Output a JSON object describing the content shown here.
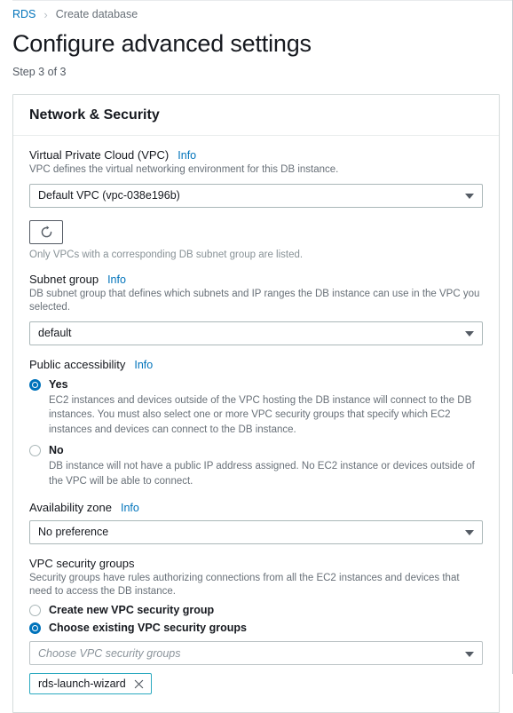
{
  "breadcrumb": {
    "root": "RDS",
    "separator": "›",
    "current": "Create database"
  },
  "header": {
    "title": "Configure advanced settings",
    "step": "Step 3 of 3"
  },
  "panel": {
    "title": "Network & Security"
  },
  "colors": {
    "link": "#0073bb",
    "accent_radio": "#0073bb",
    "token_border": "#2aa9bf",
    "label_text": "#16191f",
    "desc_text": "#687078"
  },
  "fields": {
    "vpc": {
      "label": "Virtual Private Cloud (VPC)",
      "info": "Info",
      "description": "VPC defines the virtual networking environment for this DB instance.",
      "value": "Default VPC (vpc-038e196b)"
    },
    "refresh": {
      "icon": "refresh-icon",
      "note": "Only VPCs with a corresponding DB subnet group are listed."
    },
    "subnet_group": {
      "label": "Subnet group",
      "info": "Info",
      "description": "DB subnet group that defines which subnets and IP ranges the DB instance can use in the VPC you selected.",
      "value": "default"
    },
    "public_accessibility": {
      "label": "Public accessibility",
      "info": "Info",
      "options": [
        {
          "label": "Yes",
          "selected": true,
          "description": "EC2 instances and devices outside of the VPC hosting the DB instance will connect to the DB instances. You must also select one or more VPC security groups that specify which EC2 instances and devices can connect to the DB instance."
        },
        {
          "label": "No",
          "selected": false,
          "description": "DB instance will not have a public IP address assigned. No EC2 instance or devices outside of the VPC will be able to connect."
        }
      ]
    },
    "availability_zone": {
      "label": "Availability zone",
      "info": "Info",
      "value": "No preference"
    },
    "vpc_security_groups": {
      "label": "VPC security groups",
      "description": "Security groups have rules authorizing connections from all the EC2 instances and devices that need to access the DB instance.",
      "options": [
        {
          "label": "Create new VPC security group",
          "selected": false
        },
        {
          "label": "Choose existing VPC security groups",
          "selected": true
        }
      ],
      "select_placeholder": "Choose VPC security groups",
      "tokens": [
        {
          "label": "rds-launch-wizard",
          "remove_icon": "close-icon"
        }
      ]
    }
  }
}
